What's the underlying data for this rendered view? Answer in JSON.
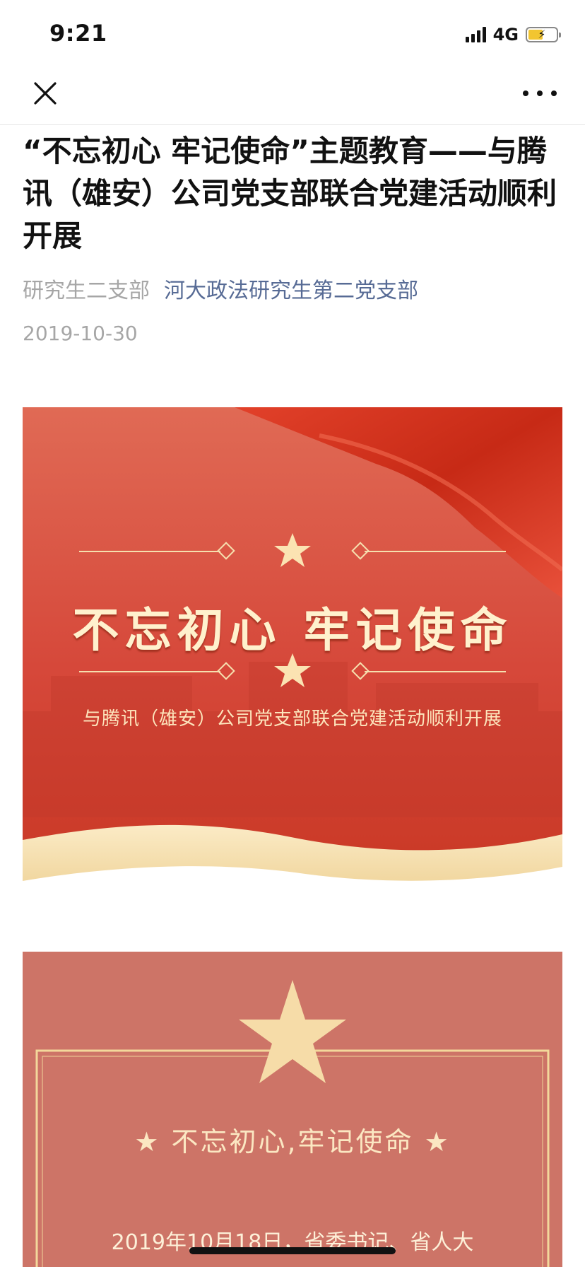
{
  "status_bar": {
    "time": "9:21",
    "network": "4G",
    "battery_level": 0.52,
    "icons": [
      "signal-icon",
      "battery-charging-icon"
    ]
  },
  "nav": {
    "close_icon": "close-icon",
    "more_icon": "more-dots-icon"
  },
  "article": {
    "title": "“不忘初心 牢记使命”主题教育——与腾讯（雄安）公司党支部联合党建活动顺利开展",
    "author": "研究生二支部",
    "account": "河大政法研究生第二党支部",
    "date": "2019-10-30"
  },
  "banner": {
    "heading": "不忘初心 牢记使命",
    "subtitle": "与腾讯（雄安）公司党支部联合党建活动顺利开展",
    "colors": {
      "red": "#d9402d",
      "gold": "#f6dfae",
      "text": "#fff1cd"
    }
  },
  "card2": {
    "heading": "★ 不忘初心,牢记使命 ★",
    "body_line": "2019年10月18日，省委书记、省人大",
    "colors": {
      "background": "#cd7467",
      "gold": "#f3d89b"
    }
  },
  "colors": {
    "link": "#576b95",
    "meta": "#a6a6a6"
  }
}
